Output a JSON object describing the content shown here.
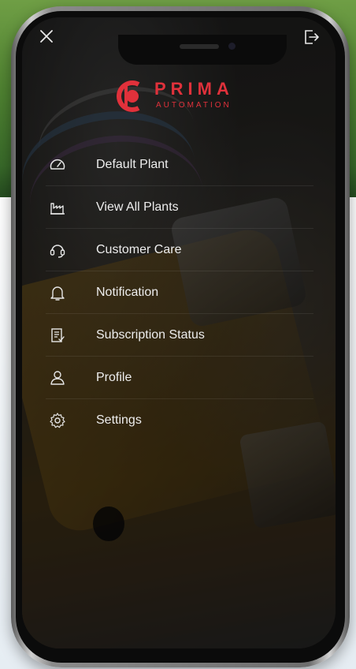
{
  "brand": {
    "name": "PRIMA",
    "tagline": "AUTOMATION",
    "color": "#e0313b"
  },
  "top_bar": {
    "close_icon": "close-icon",
    "logout_icon": "logout-icon"
  },
  "menu": {
    "items": [
      {
        "label": "Default Plant",
        "icon": "gauge-icon"
      },
      {
        "label": "View All Plants",
        "icon": "factory-icon"
      },
      {
        "label": "Customer Care",
        "icon": "headset-icon"
      },
      {
        "label": "Notification",
        "icon": "bell-icon"
      },
      {
        "label": "Subscription Status",
        "icon": "document-list-icon"
      },
      {
        "label": "Profile",
        "icon": "user-icon"
      },
      {
        "label": "Settings",
        "icon": "gear-icon"
      }
    ]
  }
}
